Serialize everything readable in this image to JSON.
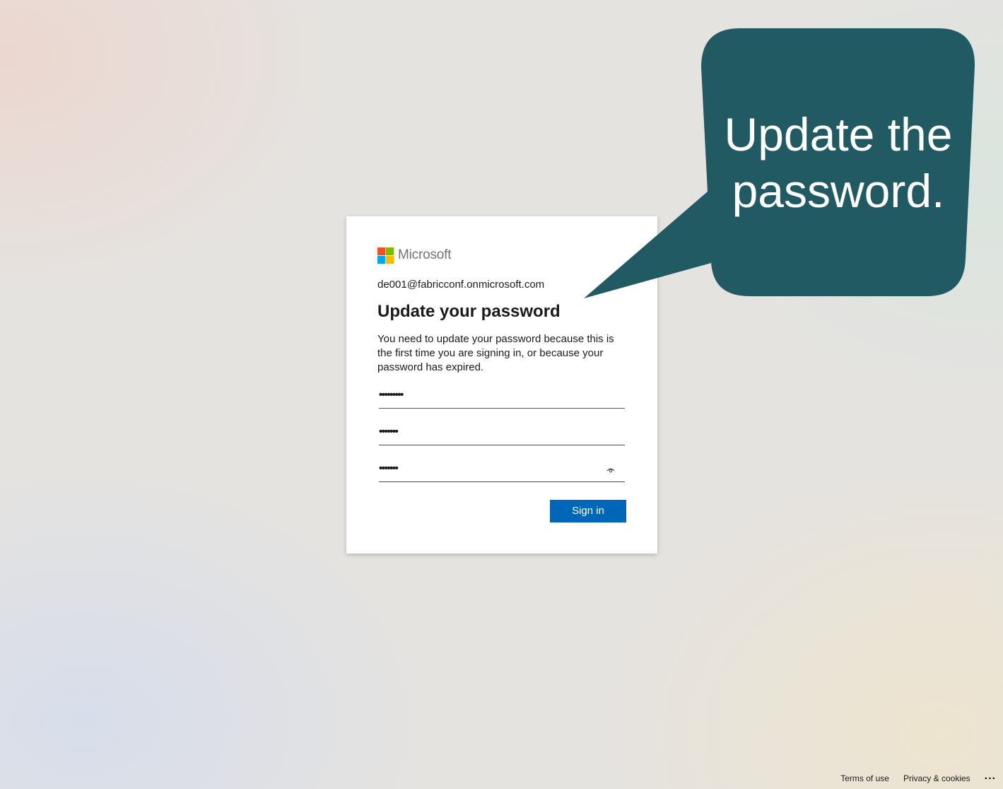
{
  "brand": {
    "name": "Microsoft",
    "logo_colors": [
      "#f25022",
      "#7fba00",
      "#00a4ef",
      "#ffb900"
    ]
  },
  "signin_card": {
    "identity": "de001@fabricconf.onmicrosoft.com",
    "title": "Update your password",
    "description": "You need to update your password because this is the first time you are signing in, or because your password has expired.",
    "current_password": "•••••••••",
    "new_password": "•••••••",
    "confirm_password": "•••••••",
    "submit_label": "Sign in",
    "accent_color": "#0067b8"
  },
  "callout": {
    "text": "Update the\npassword.",
    "color": "#215a63"
  },
  "footer": {
    "terms": "Terms of use",
    "privacy": "Privacy & cookies",
    "more": "..."
  }
}
